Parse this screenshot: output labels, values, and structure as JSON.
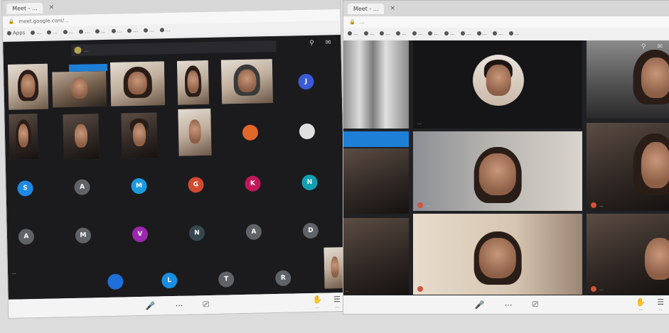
{
  "left_window": {
    "tab_title": "Meet - ...",
    "address": "meet.google.com/...",
    "bookmarks": [
      "Apps",
      "...",
      "...",
      "...",
      "...",
      "...",
      "...",
      "...",
      "...",
      "..."
    ],
    "banner_text": "...",
    "tiles": [
      {
        "kind": "photo",
        "name": "..."
      },
      {
        "kind": "photo",
        "name": ""
      },
      {
        "kind": "photo",
        "name": ""
      },
      {
        "kind": "photo",
        "name": ""
      },
      {
        "kind": "photo",
        "name": ""
      },
      {
        "kind": "photo",
        "name": ""
      },
      {
        "kind": "photo",
        "name": ""
      },
      {
        "kind": "photo",
        "name": ""
      },
      {
        "kind": "photo",
        "name": ""
      }
    ],
    "avatars": [
      {
        "letter": "J",
        "color": "#3b5bd6"
      },
      {
        "letter": "",
        "color": "#e0e0e0"
      },
      {
        "letter": "",
        "color": "#e2672a"
      },
      {
        "letter": "S",
        "color": "#1e88e5"
      },
      {
        "letter": "A",
        "color": "#5f6368"
      },
      {
        "letter": "M",
        "color": "#1a9be0"
      },
      {
        "letter": "G",
        "color": "#d24a2f"
      },
      {
        "letter": "K",
        "color": "#c2185b"
      },
      {
        "letter": "N",
        "color": "#12a0b0"
      },
      {
        "letter": "A",
        "color": "#5f6368"
      },
      {
        "letter": "M",
        "color": "#5f6368"
      },
      {
        "letter": "V",
        "color": "#9c27b0"
      },
      {
        "letter": "N",
        "color": "#37474f"
      },
      {
        "letter": "A",
        "color": "#5f6368"
      },
      {
        "letter": "D",
        "color": "#5f6368"
      },
      {
        "letter": "",
        "color": "#1e6fd9"
      },
      {
        "letter": "L",
        "color": "#1a8ee0"
      },
      {
        "letter": "T",
        "color": "#5f6368"
      },
      {
        "letter": "R",
        "color": "#5f6368"
      }
    ],
    "bottom_name": "...",
    "bottom_right": [
      "...",
      "..."
    ]
  },
  "right_window": {
    "tab_title": "Meet - ...",
    "address": "...",
    "bookmarks": [
      "...",
      "...",
      "...",
      "...",
      "...",
      "...",
      "...",
      "...",
      "...",
      "...",
      "..."
    ],
    "main_tiles": [
      {
        "name": "..."
      },
      {
        "name": "..."
      },
      {
        "name": ""
      }
    ],
    "side_tiles": [
      {
        "name": ""
      },
      {
        "name": "..."
      },
      {
        "name": ""
      },
      {
        "name": "..."
      }
    ],
    "left_tiles": [
      {
        "name": ""
      },
      {
        "name": ""
      },
      {
        "name": "..."
      }
    ],
    "bottom_right": [
      "...",
      "..."
    ]
  },
  "bottom_controls": {
    "mic": "🎤",
    "dots": "⋯",
    "cam": "⎚",
    "raise_hand": "✋",
    "chat": "☰"
  }
}
